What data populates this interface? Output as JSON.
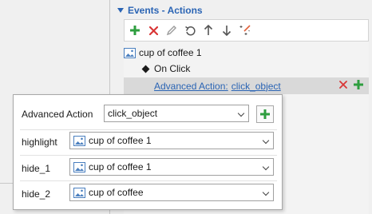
{
  "colors": {
    "accent": "#2a64b4",
    "add_green": "#2e9e3f",
    "delete_red": "#d93636"
  },
  "panel": {
    "header": "Events - Actions",
    "toolbar_icons": [
      "add-icon",
      "delete-icon",
      "edit-icon",
      "undo-icon",
      "move-up-icon",
      "move-down-icon",
      "magic-wand-icon"
    ]
  },
  "tree": {
    "event_object": "cup of coffee 1",
    "trigger": "On Click",
    "action_prefix": "Advanced Action:",
    "action_name": "click_object"
  },
  "popup": {
    "advanced_action_label": "Advanced Action",
    "advanced_action_value": "click_object",
    "params": [
      {
        "label": "highlight",
        "value": "cup of coffee 1"
      },
      {
        "label": "hide_1",
        "value": "cup of coffee 1"
      },
      {
        "label": "hide_2",
        "value": "cup of coffee"
      }
    ]
  }
}
